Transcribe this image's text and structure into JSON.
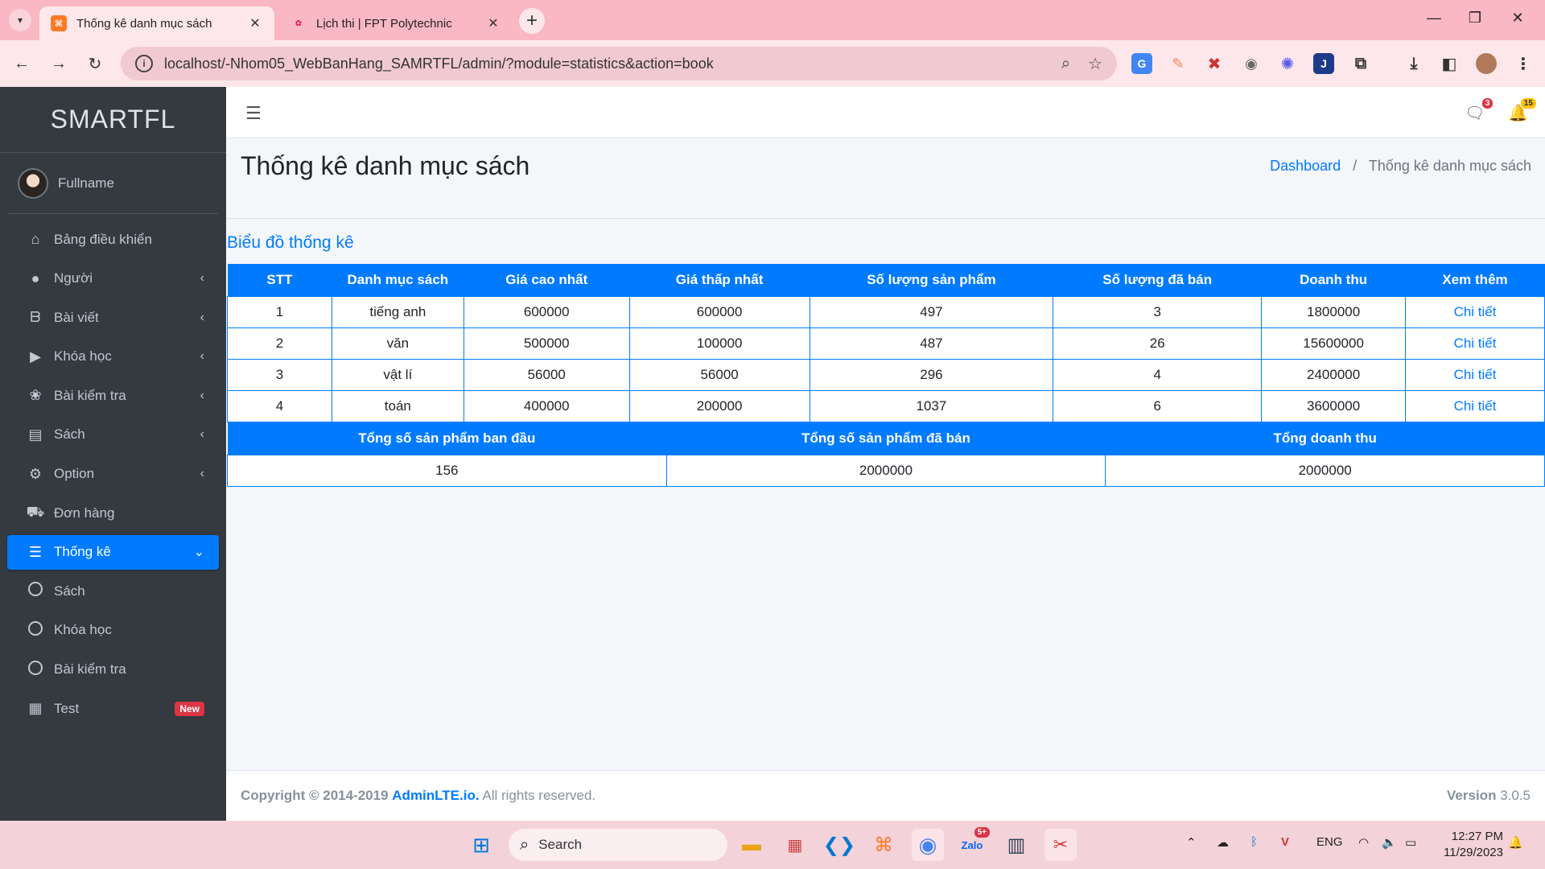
{
  "browser": {
    "tabs": [
      {
        "title": "Thống kê danh mục sách",
        "close": "✕",
        "favicon": "xampp-icon"
      },
      {
        "title": "Lịch thi | FPT Polytechnic",
        "close": "✕",
        "favicon": "fpt-icon"
      }
    ],
    "new_tab": "+",
    "url": "localhost/-Nhom05_WebBanHang_SAMRTFL/admin/?module=statistics&action=book"
  },
  "sidebar": {
    "brand": "SMARTFL",
    "user": "Fullname",
    "items": [
      {
        "label": "Bảng điều khiển",
        "icon": "home-icon"
      },
      {
        "label": "Người",
        "icon": "user-icon"
      },
      {
        "label": "Bài viết",
        "icon": "blog-icon"
      },
      {
        "label": "Khóa học",
        "icon": "video-icon"
      },
      {
        "label": "Bài kiểm tra",
        "icon": "paw-icon"
      },
      {
        "label": "Sách",
        "icon": "book-icon"
      },
      {
        "label": "Option",
        "icon": "gear-icon"
      },
      {
        "label": "Đơn hàng",
        "icon": "truck-icon"
      },
      {
        "label": "Thống kê",
        "icon": "stats-icon"
      },
      {
        "label": "Sách",
        "icon": "circle-icon"
      },
      {
        "label": "Khóa học",
        "icon": "circle-icon"
      },
      {
        "label": "Bài kiểm tra",
        "icon": "circle-icon"
      },
      {
        "label": "Test",
        "icon": "grid-icon",
        "badge": "New"
      }
    ]
  },
  "header": {
    "messages_count": "3",
    "notifications_count": "15"
  },
  "content": {
    "page_title": "Thống kê danh mục sách",
    "breadcrumb": {
      "home": "Dashboard",
      "sep": "/",
      "current": "Thống kê danh mục sách"
    },
    "section_title": "Biểu đồ thống kê",
    "table": {
      "headers": [
        "STT",
        "Danh mục sách",
        "Giá cao nhất",
        "Giá thấp nhất",
        "Số lượng sản phẩm",
        "Số lượng đã bán",
        "Doanh thu",
        "Xem thêm"
      ],
      "rows": [
        [
          "1",
          "tiếng anh",
          "600000",
          "600000",
          "497",
          "3",
          "1800000",
          "Chi tiết"
        ],
        [
          "2",
          "văn",
          "500000",
          "100000",
          "487",
          "26",
          "15600000",
          "Chi tiết"
        ],
        [
          "3",
          "vật lí",
          "56000",
          "56000",
          "296",
          "4",
          "2400000",
          "Chi tiết"
        ],
        [
          "4",
          "toán",
          "400000",
          "200000",
          "1037",
          "6",
          "3600000",
          "Chi tiết"
        ]
      ]
    },
    "totals": {
      "headers": [
        "Tổng số sản phẩm ban đầu",
        "Tổng số sản phẩm đã bán",
        "Tổng doanh thu"
      ],
      "values": [
        "156",
        "2000000",
        "2000000"
      ]
    }
  },
  "footer": {
    "copyright": "Copyright © 2014-2019",
    "brand": "AdminLTE.io.",
    "rights": "All rights reserved.",
    "version_label": "Version",
    "version": "3.0.5"
  },
  "taskbar": {
    "search": "Search",
    "lang": "ENG",
    "time": "12:27 PM",
    "date": "11/29/2023",
    "zalo_badge": "5+"
  },
  "colors": {
    "primary": "#007bff",
    "sidebar_bg": "#343a40",
    "badge_red": "#dc3545",
    "badge_yellow": "#ffc107",
    "browser_accent": "#f9b8c4"
  }
}
